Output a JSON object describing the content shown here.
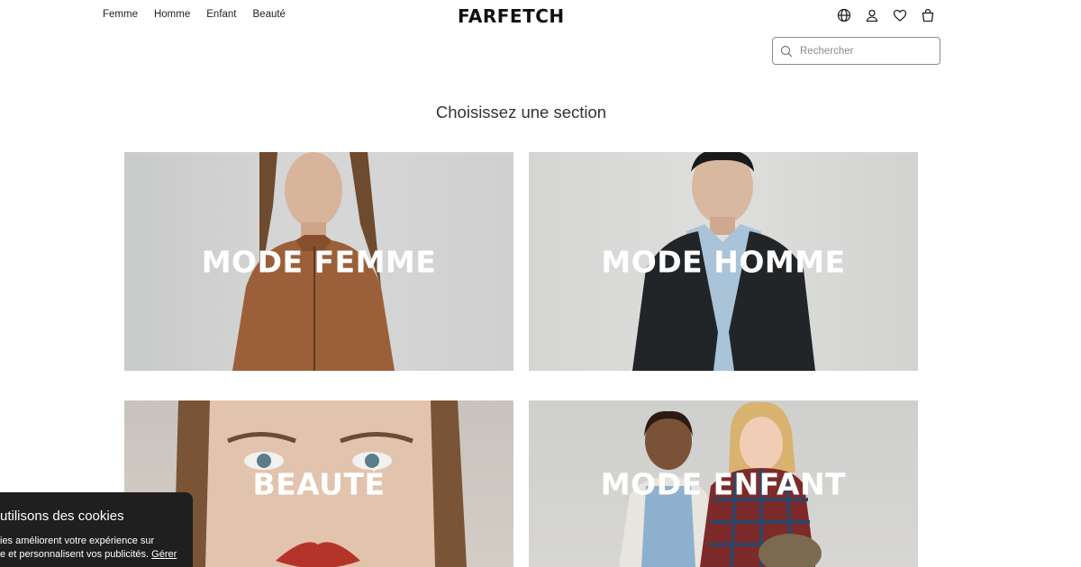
{
  "nav": {
    "items": [
      {
        "label": "Femme"
      },
      {
        "label": "Homme"
      },
      {
        "label": "Enfant"
      },
      {
        "label": "Beauté"
      }
    ]
  },
  "brand": {
    "name": "FARFETCH"
  },
  "header_icons": [
    "globe-icon",
    "user-icon",
    "heart-icon",
    "bag-icon"
  ],
  "search": {
    "placeholder": "Rechercher",
    "value": ""
  },
  "section": {
    "title": "Choisissez une section"
  },
  "tiles": [
    {
      "label": "MODE FEMME"
    },
    {
      "label": "MODE HOMME"
    },
    {
      "label": "BEAUTÉ"
    },
    {
      "label": "MODE ENFANT"
    }
  ],
  "cookie_banner": {
    "title": "utilisons des cookies",
    "line1": "ies améliorent votre expérience sur",
    "line2": "e et personnalisent vos publicités.",
    "manage_link": "Gérer"
  },
  "colors": {
    "text": "#222222",
    "banner_bg": "#1f1f1f",
    "tile_label": "#ffffff"
  }
}
